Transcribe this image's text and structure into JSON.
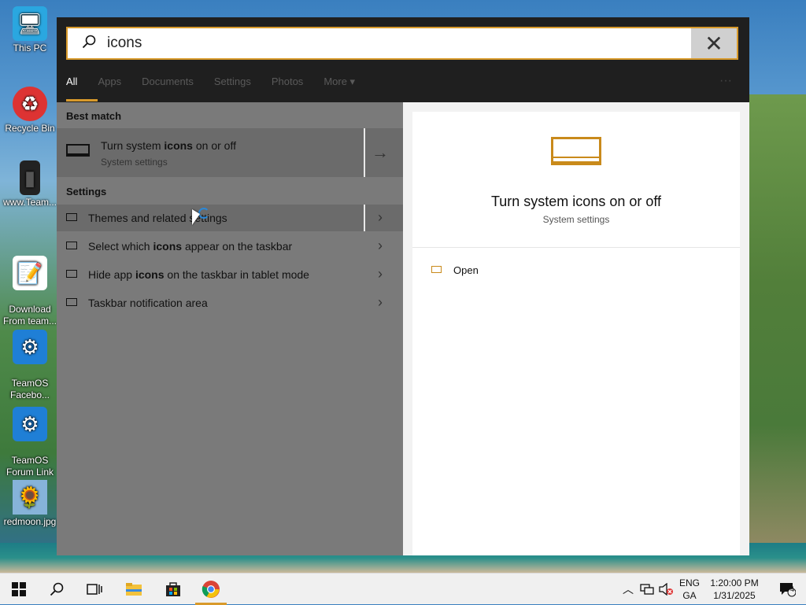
{
  "desktop": {
    "icons": [
      {
        "label": "This PC",
        "glyph": "🖥"
      },
      {
        "label": "Recycle Bin",
        "glyph": "♻"
      },
      {
        "label": "www.Team...",
        "glyph": "▮"
      },
      {
        "label": "Download\nFrom team...",
        "glyph": "📝"
      },
      {
        "label": "TeamOS\nFacebo...",
        "glyph": "⚙"
      },
      {
        "label": "TeamOS\nForum Link",
        "glyph": "⚙"
      },
      {
        "label": "redmoon.jpg",
        "glyph": "🌻"
      }
    ]
  },
  "search": {
    "query": "icons",
    "clear_glyph": "✕",
    "tabs": [
      "All",
      "Apps",
      "Documents",
      "Settings",
      "Photos",
      "More ▾"
    ],
    "more_glyph": "···"
  },
  "results": {
    "best_match_label": "Best match",
    "best": {
      "title_pre": "Turn system ",
      "title_bold": "icons",
      "title_post": " on or off",
      "subtitle": "System settings"
    },
    "settings_label": "Settings",
    "items": [
      {
        "pre": "Themes and related settings",
        "bold": "",
        "post": ""
      },
      {
        "pre": "Select which ",
        "bold": "icons",
        "post": " appear on the taskbar"
      },
      {
        "pre": "Hide app ",
        "bold": "icons",
        "post": " on the taskbar in tablet mode"
      },
      {
        "pre": "Taskbar notification area",
        "bold": "",
        "post": ""
      }
    ]
  },
  "preview": {
    "title": "Turn system icons on or off",
    "subtitle": "System settings",
    "open_label": "Open"
  },
  "taskbar": {
    "lang_top": "ENG",
    "lang_bottom": "GA",
    "time": "1:20:00 PM",
    "date": "1/31/2025",
    "notification_count": "4"
  },
  "colors": {
    "accent": "#d89a2b",
    "preview_icon": "#c98a1b"
  }
}
